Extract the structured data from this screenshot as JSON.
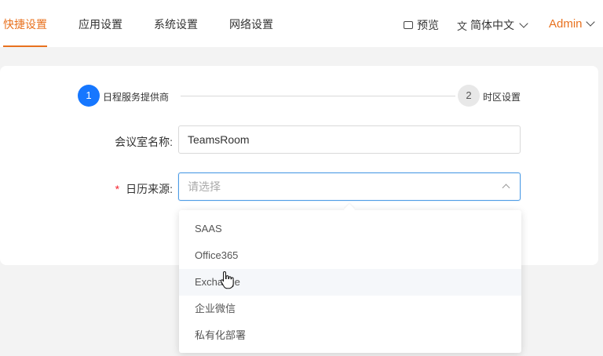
{
  "nav": {
    "tabs": [
      {
        "label": "快捷设置",
        "active": true
      },
      {
        "label": "应用设置",
        "active": false
      },
      {
        "label": "系统设置",
        "active": false
      },
      {
        "label": "网络设置",
        "active": false
      }
    ],
    "preview_label": "预览",
    "language_label": "简体中文",
    "user_label": "Admin"
  },
  "steps": [
    {
      "number": "1",
      "label": "日程服务提供商",
      "state": "active"
    },
    {
      "number": "2",
      "label": "时区设置",
      "state": "pending"
    }
  ],
  "form": {
    "room_name_label": "会议室名称:",
    "room_name_value": "TeamsRoom",
    "calendar_source_required": "*",
    "calendar_source_label": "日历来源:",
    "calendar_source_placeholder": "请选择"
  },
  "dropdown": {
    "options": [
      "SAAS",
      "Office365",
      "Exchange",
      "企业微信",
      "私有化部署"
    ],
    "hovered": "Exchange"
  },
  "colors": {
    "accent": "#e8711e",
    "primary": "#1677ff",
    "required": "#f5222d"
  }
}
